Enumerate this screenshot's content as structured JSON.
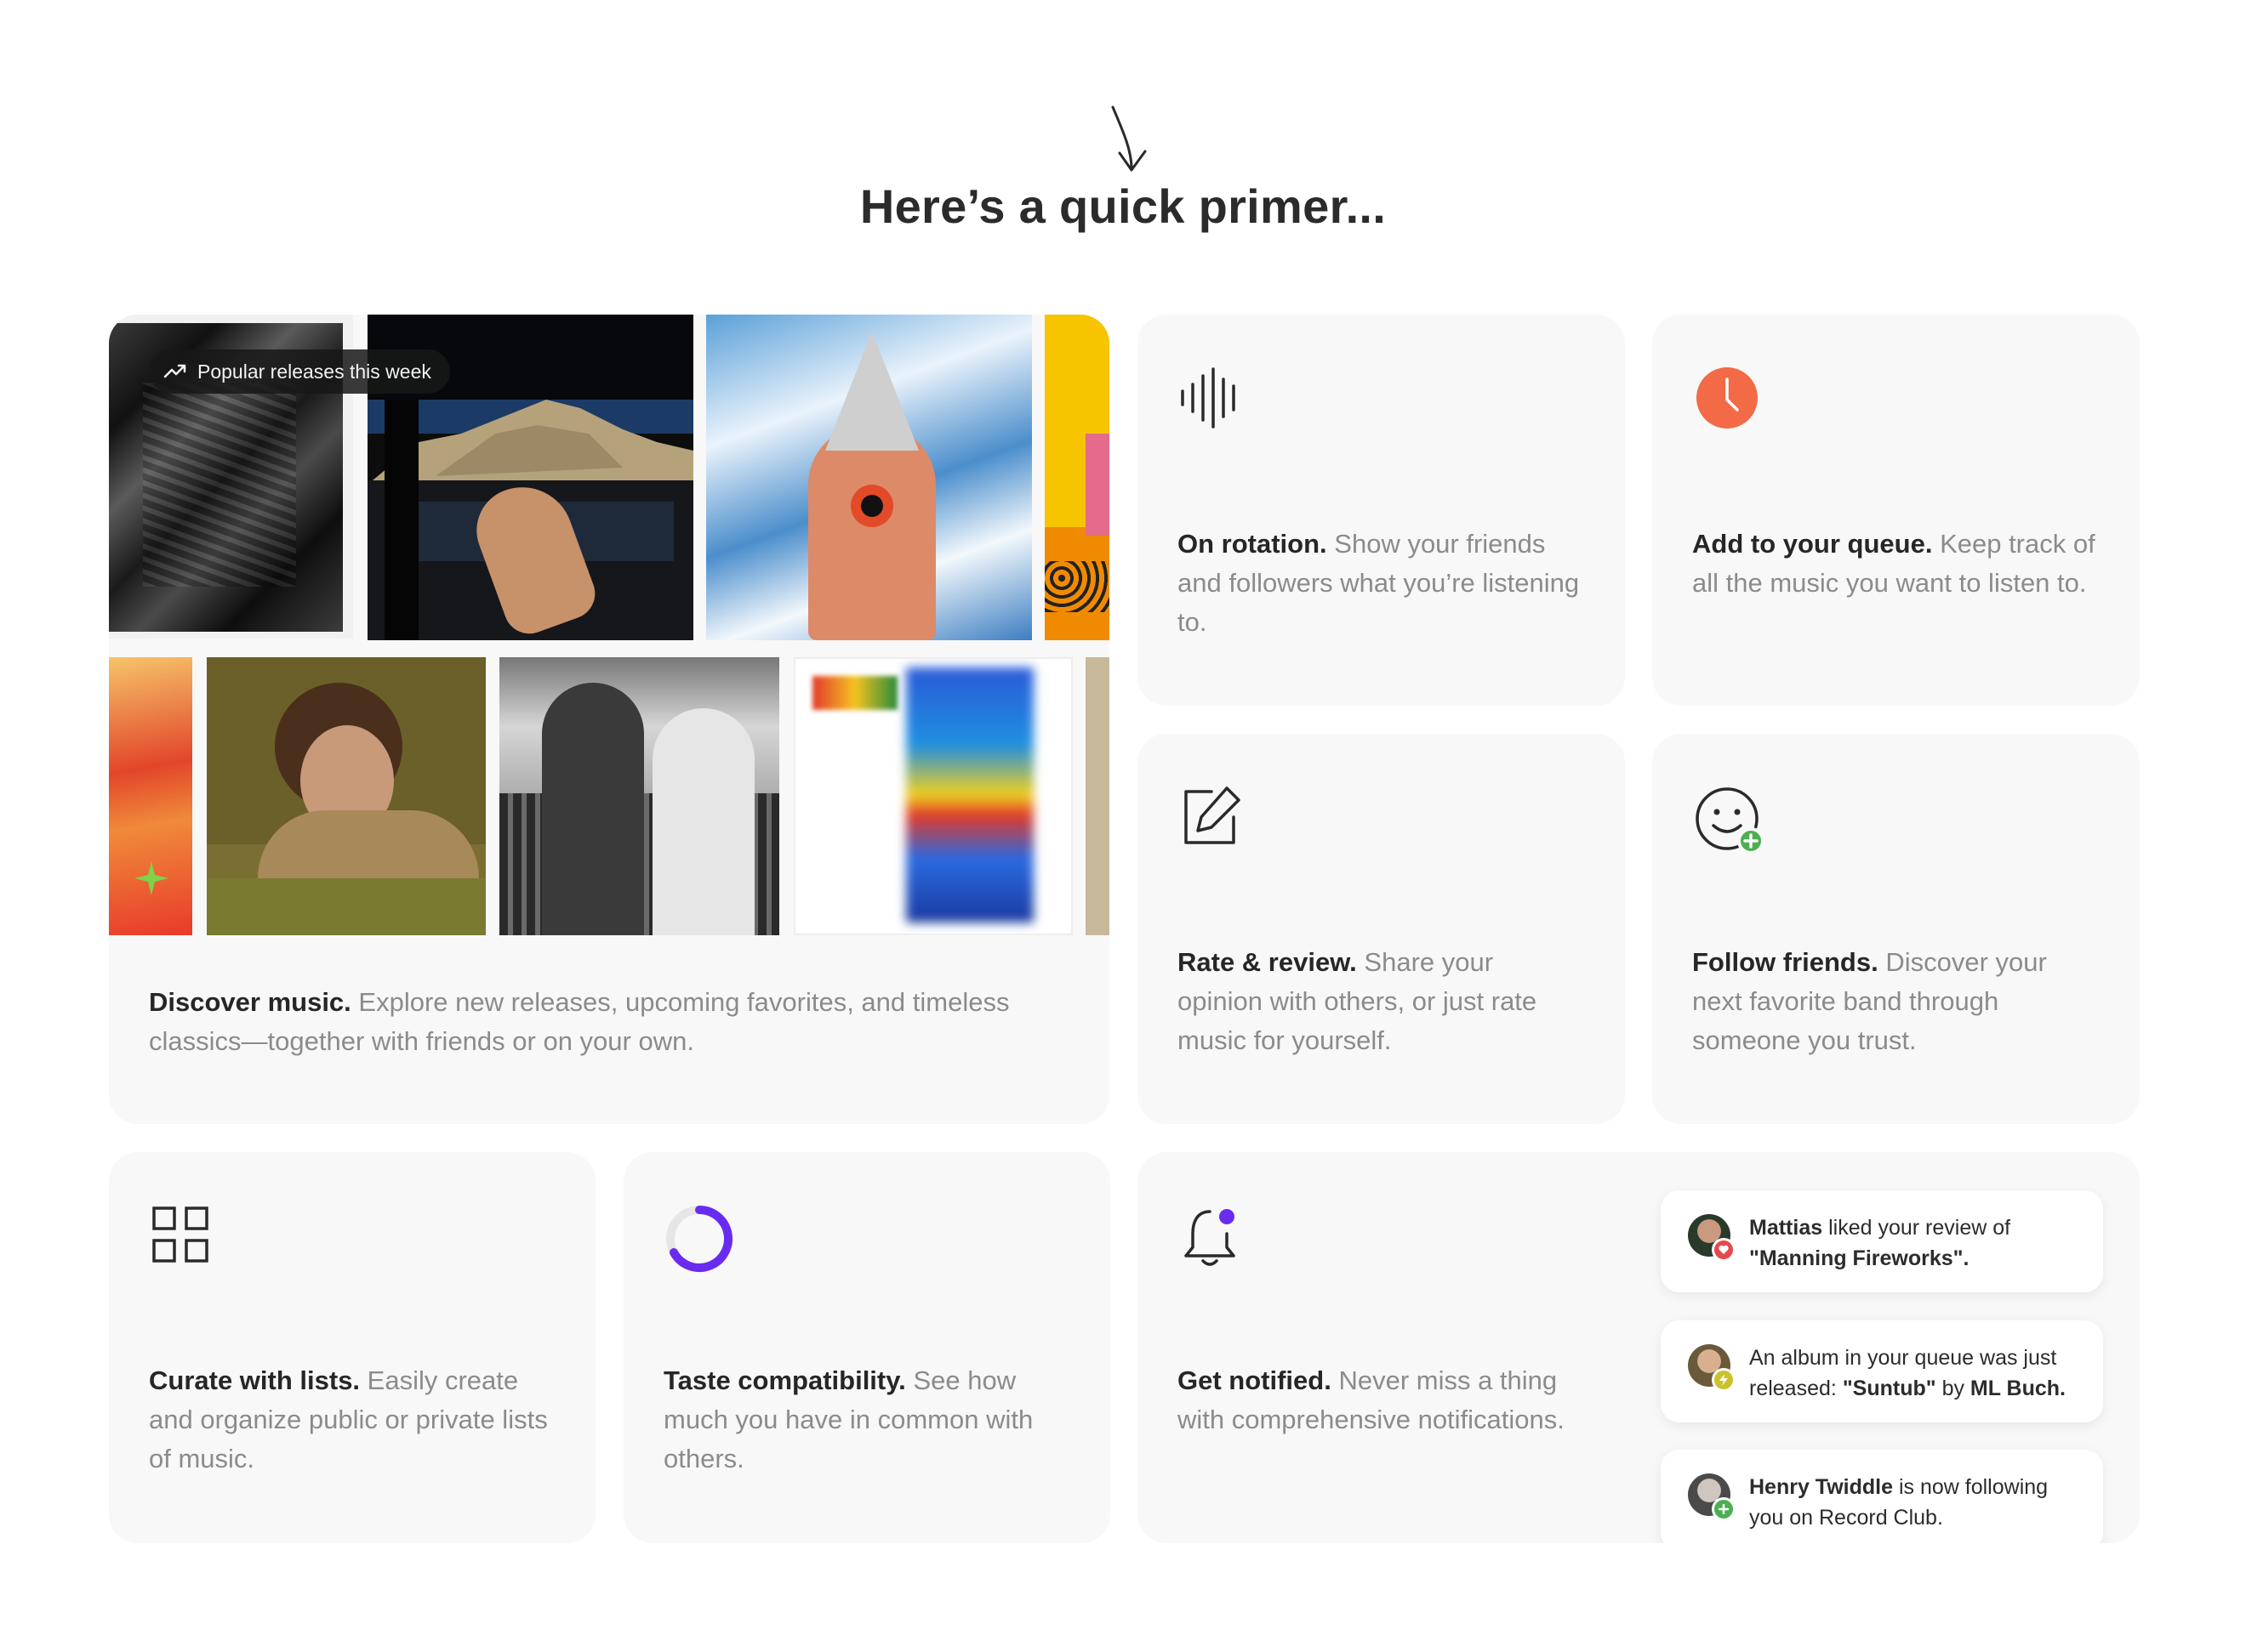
{
  "header": {
    "title": "Here’s a quick primer..."
  },
  "discover": {
    "badge": "Popular releases this week",
    "title": "Discover music.",
    "body": "Explore new releases, upcoming favorites, and timeless classics—together with friends or on your own."
  },
  "features": {
    "rotation": {
      "title": "On rotation.",
      "body": "Show your friends and followers what you’re listening to.",
      "icon": "sound-wave-icon"
    },
    "queue": {
      "title": "Add to your queue.",
      "body": "Keep track of all the music you want to listen to.",
      "icon": "clock-icon"
    },
    "rate": {
      "title": "Rate & review.",
      "body": "Share your opinion with others, or just rate music for yourself.",
      "icon": "edit-icon"
    },
    "follow": {
      "title": "Follow friends.",
      "body": "Discover your next favorite band through someone you trust.",
      "icon": "smile-plus-icon"
    },
    "lists": {
      "title": "Curate with lists.",
      "body": "Easily create and organize public or private lists of music.",
      "icon": "grid-icon"
    },
    "taste": {
      "title": "Taste compatibility.",
      "body": "See how much you have in common with others.",
      "icon": "progress-ring-icon"
    },
    "notify": {
      "title": "Get notified.",
      "body": "Never miss a thing with comprehensive notifications.",
      "icon": "bell-icon"
    }
  },
  "notifications": [
    {
      "user": "Mattias",
      "text": "liked your review of",
      "item": "\"Manning Fireworks\"."
    },
    {
      "prefix": "An album in your queue was just released:",
      "item": "\"Suntub\"",
      "joiner": "by",
      "artist": "ML Buch."
    },
    {
      "user": "Henry Twiddle",
      "text": "is now following you on Record Club."
    }
  ],
  "colors": {
    "accent_orange": "#f26a46",
    "accent_purple": "#6a2bf0",
    "card_bg": "#f8f8f8",
    "heart_red": "#e5484d",
    "lightning_yellow": "#c9c22a",
    "follow_green": "#4caf50"
  }
}
